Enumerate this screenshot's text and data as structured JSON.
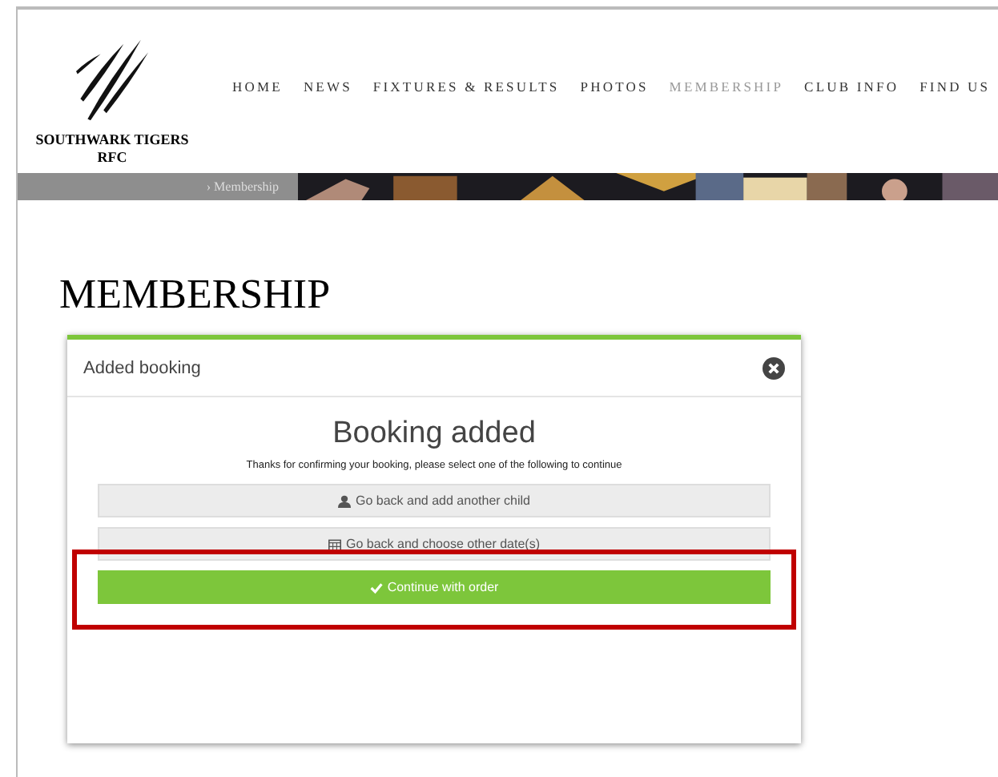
{
  "logo": {
    "name": "SOUTHWARK TIGERS",
    "subname": "RFC"
  },
  "nav": [
    {
      "label": "HOME",
      "selected": false
    },
    {
      "label": "NEWS",
      "selected": false
    },
    {
      "label": "FIXTURES & RESULTS",
      "selected": false
    },
    {
      "label": "PHOTOS",
      "selected": false
    },
    {
      "label": "MEMBERSHIP",
      "selected": true
    },
    {
      "label": "CLUB INFO",
      "selected": false
    },
    {
      "label": "FIND US",
      "selected": false
    }
  ],
  "banner": {
    "breadcrumb": "› Membership",
    "kind": "picture"
  },
  "page_title": "MEMBERSHIP",
  "modal": {
    "title": "Added booking",
    "heading": "Booking added",
    "message": "Thanks for confirming your booking, please select one of the following to continue",
    "buttons": [
      {
        "kind": "user",
        "label": "Go back and add another child",
        "highlighted": false
      },
      {
        "kind": "calendar",
        "label": "Go back and choose other date(s)",
        "highlighted": false
      },
      {
        "kind": "confirm",
        "label": "Continue with order",
        "highlighted": true
      }
    ]
  }
}
